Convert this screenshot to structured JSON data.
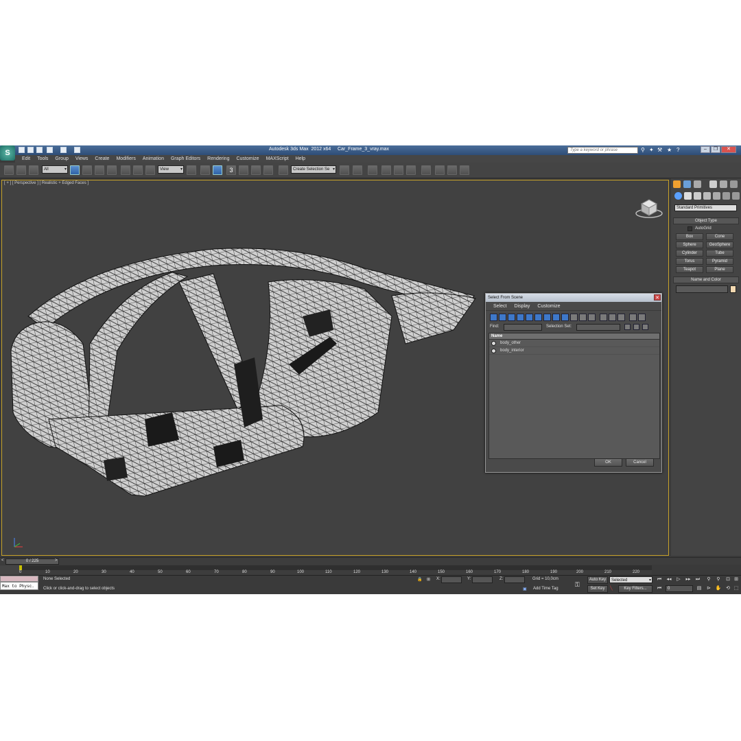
{
  "window": {
    "title": "Autodesk 3ds Max  2012 x64     Car_Frame_3_vray.max",
    "search_placeholder": "Type a keyword or phrase",
    "logo_label": "S"
  },
  "menu": [
    "Edit",
    "Tools",
    "Group",
    "Views",
    "Create",
    "Modifiers",
    "Animation",
    "Graph Editors",
    "Rendering",
    "Customize",
    "MAXScript",
    "Help"
  ],
  "toolbar": {
    "selection_filter": "All",
    "reference_coord": "View",
    "snap_label": "3",
    "named_selection_set": "Create Selection Se"
  },
  "viewport": {
    "label": "[ + ] [ Perspective ] [ Realistic + Edged Faces ]"
  },
  "dialog": {
    "title": "Select From Scene",
    "close_glyph": "✕",
    "menu": [
      "Select",
      "Display",
      "Customize"
    ],
    "find_label": "Find:",
    "selection_set_label": "Selection Set:",
    "column_name": "Name",
    "items": [
      "body_other",
      "body_interior"
    ],
    "ok_label": "OK",
    "cancel_label": "Cancel"
  },
  "command_panel": {
    "category": "Standard Primitives",
    "object_type_header": "Object Type",
    "autogrid_label": "AutoGrid",
    "primitives": [
      "Box",
      "Cone",
      "Sphere",
      "GeoSphere",
      "Cylinder",
      "Tube",
      "Torus",
      "Pyramid",
      "Teapot",
      "Plane"
    ],
    "name_color_header": "Name and Color"
  },
  "timeline": {
    "frame_display": "0 / 225",
    "ticks": [
      "0",
      "10",
      "20",
      "30",
      "40",
      "50",
      "60",
      "70",
      "80",
      "90",
      "100",
      "110",
      "120",
      "130",
      "140",
      "150",
      "160",
      "170",
      "180",
      "190",
      "200",
      "210",
      "220"
    ]
  },
  "status": {
    "maxscript_text": "Max to Physc.",
    "selection_status": "None Selected",
    "prompt": "Click or click-and-drag to select objects",
    "x_label": "X:",
    "y_label": "Y:",
    "z_label": "Z:",
    "grid": "Grid = 10,0cm",
    "add_time_tag": "Add Time Tag",
    "auto_key": "Auto Key",
    "auto_key_mode": "Selected",
    "set_key": "Set Key",
    "key_filters": "Key Filters...",
    "current_frame": "0"
  }
}
